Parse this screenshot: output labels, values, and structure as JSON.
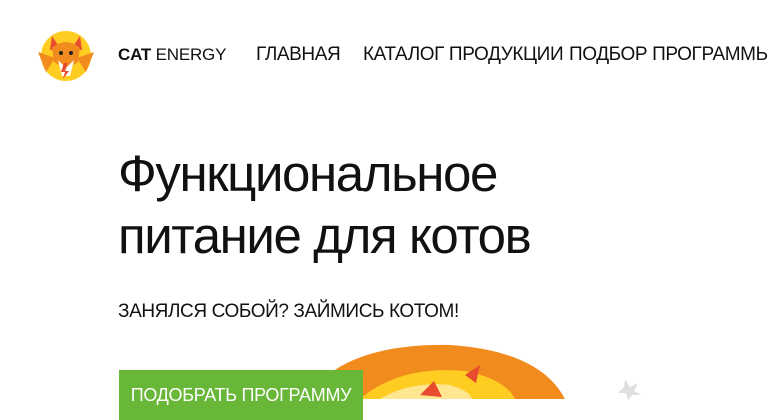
{
  "brand": {
    "name_strong": "CAT",
    "name_light": "ENERGY"
  },
  "nav": {
    "items": [
      {
        "label": "ГЛАВНАЯ"
      },
      {
        "label": "КАТАЛОГ ПРОДУКЦИИ"
      },
      {
        "label": "ПОДБОР ПРОГРАММЫ"
      }
    ]
  },
  "hero": {
    "title_line1": "Функциональное",
    "title_line2": "питание для котов",
    "subtitle": "ЗАНЯЛСЯ СОБОЙ? ЗАЙМИСЬ КОТОМ!",
    "cta_label": "ПОДОБРАТЬ ПРОГРАММУ"
  },
  "colors": {
    "accent_green": "#68b738",
    "logo_orange": "#f28b1e",
    "logo_yellow": "#ffcc22",
    "logo_red": "#e84b2e"
  },
  "icons": {
    "logo": "cat-energy-logo-icon",
    "hero_illustration": "energy-burst-illustration"
  }
}
